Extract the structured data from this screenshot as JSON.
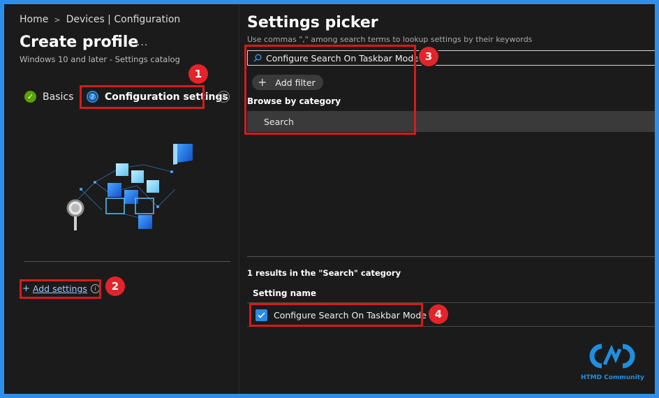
{
  "breadcrumb": {
    "home": "Home",
    "separator": ">",
    "section": "Devices | Configuration"
  },
  "profile": {
    "title": "Create profile",
    "more": "...",
    "subtitle": "Windows 10 and later - Settings catalog"
  },
  "steps": [
    {
      "number": "1",
      "label": "Basics",
      "state": "completed"
    },
    {
      "number": "2",
      "label": "Configuration settings",
      "state": "current"
    },
    {
      "number": "3",
      "label": "",
      "state": "upcoming"
    }
  ],
  "add_settings": {
    "plus": "+",
    "label": "Add settings",
    "info": "i"
  },
  "picker": {
    "title": "Settings picker",
    "hint": "Use commas \",\" among search terms to lookup settings by their keywords",
    "search_value": "Configure Search On Taskbar Mode",
    "add_filter_label": "Add filter",
    "browse_label": "Browse by category",
    "category": "Search",
    "results_text": "1 results in the \"Search\" category",
    "column_header": "Setting name",
    "result_item": "Configure Search On Taskbar Mode",
    "result_checked": true
  },
  "callouts": [
    "1",
    "2",
    "3",
    "4"
  ],
  "watermark": {
    "text": "HTMD Community"
  },
  "colors": {
    "accent": "#2a8ae8",
    "highlight": "#d41c1c",
    "success": "#57a300",
    "frame": "#2f8fe8"
  }
}
